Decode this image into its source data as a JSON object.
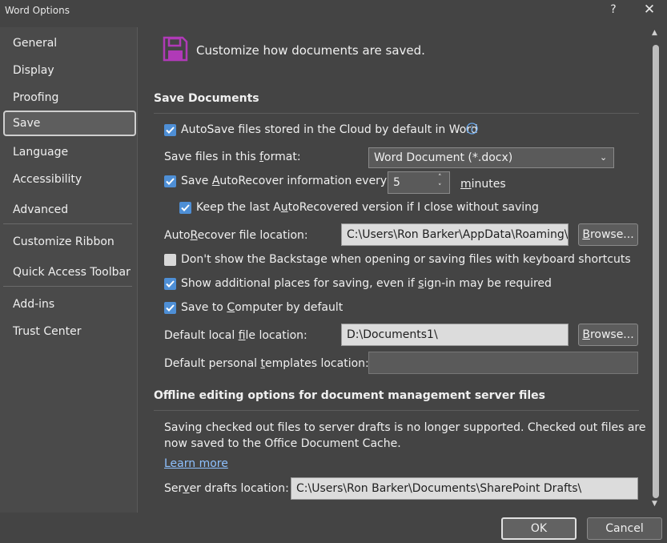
{
  "window": {
    "title": "Word Options",
    "help": "?",
    "close": "✕"
  },
  "sidebar": {
    "items": [
      {
        "label": "General"
      },
      {
        "label": "Display"
      },
      {
        "label": "Proofing"
      },
      {
        "label": "Save"
      },
      {
        "label": "Language"
      },
      {
        "label": "Accessibility"
      },
      {
        "label": "Advanced"
      },
      {
        "label": "Customize Ribbon"
      },
      {
        "label": "Quick Access Toolbar"
      },
      {
        "label": "Add-ins"
      },
      {
        "label": "Trust Center"
      }
    ],
    "selected": "Save"
  },
  "header": {
    "text": "Customize how documents are saved.",
    "icon": "save-floppy-icon",
    "icon_color": "#b03ab7"
  },
  "save_docs": {
    "heading": "Save Documents",
    "autosave_label": "AutoSave files stored in the Cloud by default in Word",
    "autosave_checked": true,
    "format_label_pre": "Save files in this ",
    "format_label_u": "f",
    "format_label_post": "ormat:",
    "format_value": "Word Document (*.docx)",
    "autorecover_label_pre": "Save ",
    "autorecover_label_u": "A",
    "autorecover_label_post": "utoRecover information every",
    "autorecover_checked": true,
    "autorecover_minutes": "5",
    "minutes_label_u": "m",
    "minutes_label_post": "inutes",
    "keep_label_pre": "Keep the last A",
    "keep_label_u": "u",
    "keep_label_post": "toRecovered version if I close without saving",
    "keep_checked": true,
    "ar_loc_label_pre": "Auto",
    "ar_loc_label_u": "R",
    "ar_loc_label_post": "ecover file location:",
    "ar_loc_value": "C:\\Users\\Ron Barker\\AppData\\Roaming\\Microsoft\\Word\\",
    "browse_u": "B",
    "browse_post": "rowse...",
    "backstage_label": "Don't show the Backstage when opening or saving files with keyboard shortcuts",
    "backstage_checked": false,
    "additional_pre": "Show additional places for saving, even if ",
    "additional_u": "s",
    "additional_post": "ign-in may be required",
    "additional_checked": true,
    "computer_pre": "Save to ",
    "computer_u": "C",
    "computer_post": "omputer by default",
    "computer_checked": true,
    "local_pre": "Default local ",
    "local_u": "f",
    "local_post": "ile location:",
    "local_value": "D:\\Documents1\\",
    "templates_pre": "Default personal ",
    "templates_u": "t",
    "templates_post": "emplates location:",
    "templates_value": ""
  },
  "offline": {
    "heading": "Offline editing options for document management server files",
    "notice_line1": "Saving checked out files to server drafts is no longer supported. Checked out files are",
    "notice_line2": "now saved to the Office Document Cache.",
    "learn_more": "Learn more",
    "drafts_pre": "Ser",
    "drafts_u": "v",
    "drafts_post": "er drafts location:",
    "drafts_value": "C:\\Users\\Ron Barker\\Documents\\SharePoint Drafts\\"
  },
  "footer": {
    "ok": "OK",
    "cancel": "Cancel"
  },
  "colors": {
    "checkbox": "#4e8fd6",
    "link": "#8ec1ff",
    "info_icon": "#6aa8ec"
  }
}
